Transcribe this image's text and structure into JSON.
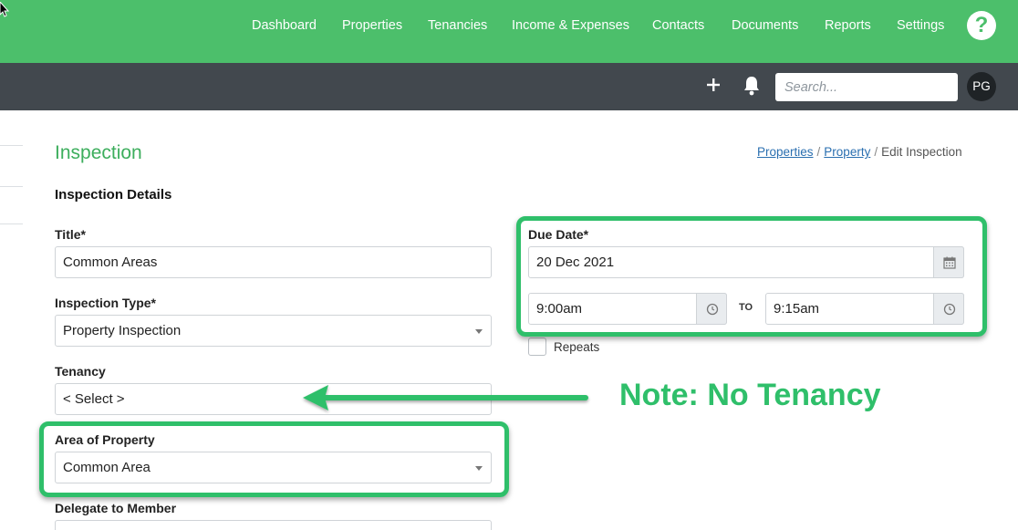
{
  "nav": {
    "items": [
      "Dashboard",
      "Properties",
      "Tenancies",
      "Income & Expenses",
      "Contacts",
      "Documents",
      "Reports",
      "Settings"
    ],
    "help_label": "?"
  },
  "toolbar": {
    "search_placeholder": "Search...",
    "avatar_initials": "PG"
  },
  "page": {
    "title": "Inspection",
    "breadcrumb": {
      "link1": "Properties",
      "link2": "Property",
      "current": "Edit Inspection",
      "separator": "/"
    },
    "section_title": "Inspection Details"
  },
  "form": {
    "title_label": "Title*",
    "title_value": "Common Areas",
    "type_label": "Inspection Type*",
    "type_value": "Property Inspection",
    "tenancy_label": "Tenancy",
    "tenancy_value": "< Select >",
    "area_label": "Area of Property",
    "area_value": "Common Area",
    "delegate_label": "Delegate to Member",
    "due_date_label": "Due Date*",
    "due_date_value": "20 Dec 2021",
    "start_time": "9:00am",
    "to_label": "TO",
    "end_time": "9:15am",
    "repeats_label": "Repeats"
  },
  "annotation": {
    "note": "Note: No Tenancy",
    "color": "#2fbf6a"
  },
  "colors": {
    "brand_green": "#4cbf6b",
    "subbar": "#42484e",
    "title_green": "#3dae5d",
    "link": "#2a6fb0"
  }
}
